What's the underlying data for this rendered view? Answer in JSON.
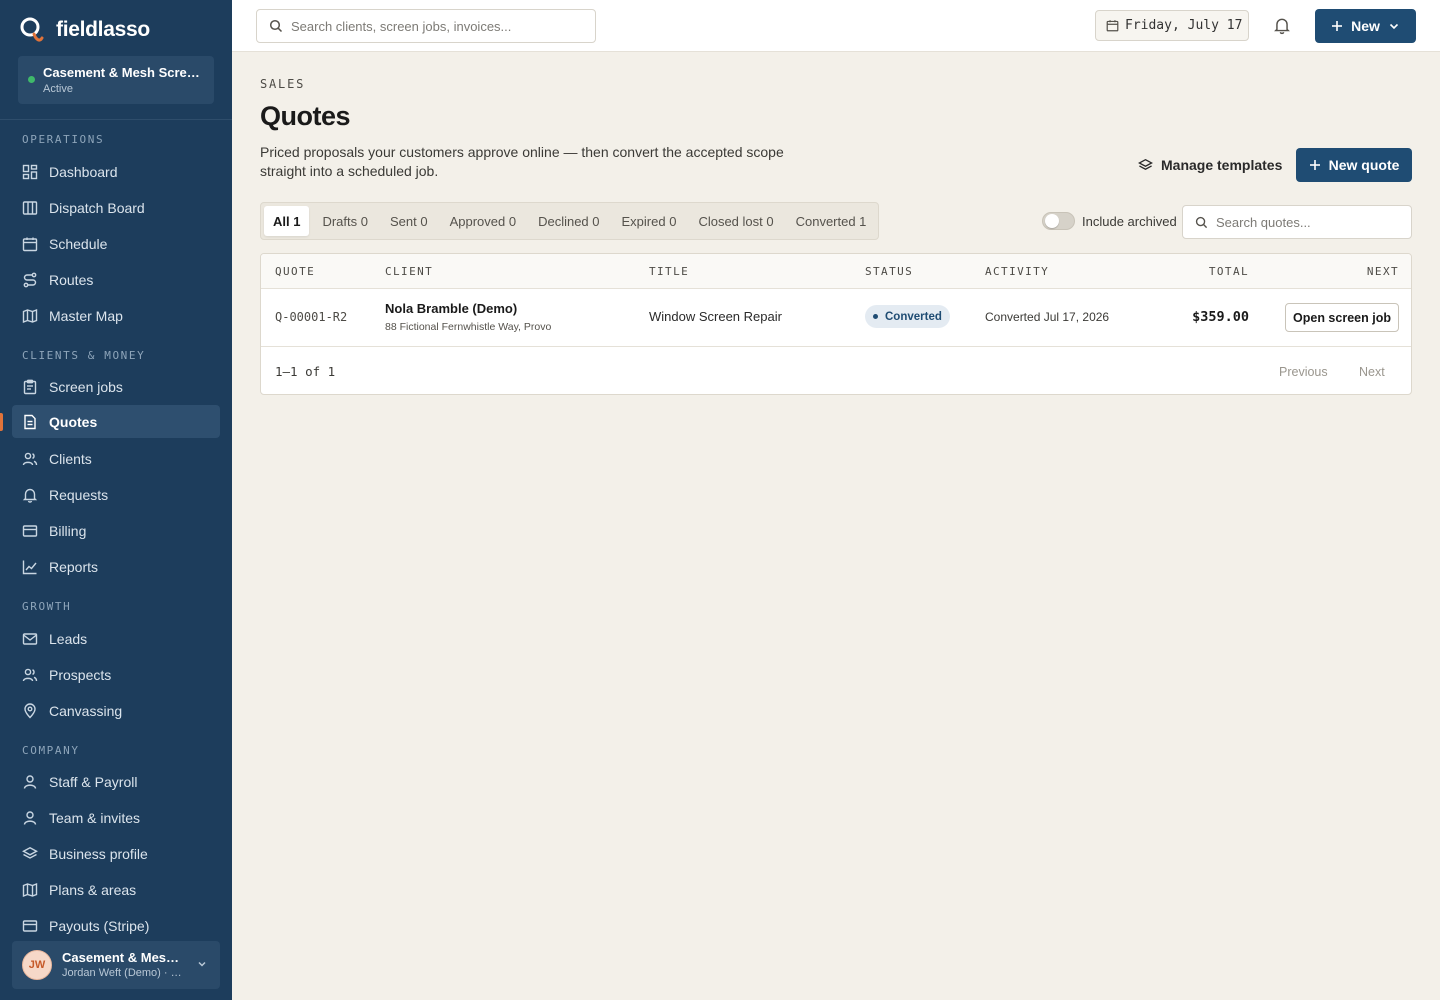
{
  "brand": {
    "name": "fieldlasso"
  },
  "org": {
    "name": "Casement & Mesh Screen...",
    "status": "Active"
  },
  "sidebar": {
    "sections": [
      {
        "label": "OPERATIONS"
      },
      {
        "label": "CLIENTS & MONEY"
      },
      {
        "label": "GROWTH"
      },
      {
        "label": "COMPANY"
      }
    ],
    "items": [
      {
        "label": "Dashboard",
        "icon": "dashboard-icon"
      },
      {
        "label": "Dispatch Board",
        "icon": "board-icon"
      },
      {
        "label": "Schedule",
        "icon": "calendar-icon"
      },
      {
        "label": "Routes",
        "icon": "route-icon"
      },
      {
        "label": "Master Map",
        "icon": "map-icon"
      },
      {
        "label": "Screen jobs",
        "icon": "clipboard-icon"
      },
      {
        "label": "Quotes",
        "icon": "document-icon",
        "active": true
      },
      {
        "label": "Clients",
        "icon": "users-icon"
      },
      {
        "label": "Requests",
        "icon": "bell-icon"
      },
      {
        "label": "Billing",
        "icon": "card-icon"
      },
      {
        "label": "Reports",
        "icon": "chart-icon"
      },
      {
        "label": "Leads",
        "icon": "mail-icon"
      },
      {
        "label": "Prospects",
        "icon": "users-icon"
      },
      {
        "label": "Canvassing",
        "icon": "pin-icon"
      },
      {
        "label": "Staff & Payroll",
        "icon": "user-icon"
      },
      {
        "label": "Team & invites",
        "icon": "user-icon"
      },
      {
        "label": "Business profile",
        "icon": "layers-icon"
      },
      {
        "label": "Plans & areas",
        "icon": "map-icon"
      },
      {
        "label": "Payouts (Stripe)",
        "icon": "card-icon"
      }
    ]
  },
  "user": {
    "initials": "JW",
    "org": "Casement & Mesh ...",
    "name": "Jordan Weft (Demo) · O..."
  },
  "topbar": {
    "search_placeholder": "Search clients, screen jobs, invoices...",
    "date": "Friday, July 17",
    "new_label": "New"
  },
  "page": {
    "eyebrow": "SALES",
    "title": "Quotes",
    "description": "Priced proposals your customers approve online — then convert the accepted scope straight into a scheduled job.",
    "manage_templates": "Manage templates",
    "new_quote": "New quote"
  },
  "tabs": [
    {
      "label": "All 1",
      "active": true
    },
    {
      "label": "Drafts 0"
    },
    {
      "label": "Sent 0"
    },
    {
      "label": "Approved 0"
    },
    {
      "label": "Declined 0"
    },
    {
      "label": "Expired 0"
    },
    {
      "label": "Closed lost 0"
    },
    {
      "label": "Converted 1"
    }
  ],
  "filters": {
    "include_archived": "Include archived",
    "include_archived_on": false,
    "search_placeholder": "Search quotes..."
  },
  "table": {
    "headers": {
      "quote": "QUOTE",
      "client": "CLIENT",
      "title": "TITLE",
      "status": "STATUS",
      "activity": "ACTIVITY",
      "total": "TOTAL",
      "next": "NEXT"
    },
    "rows": [
      {
        "quote": "Q-00001-R2",
        "client_name": "Nola Bramble (Demo)",
        "client_address": "88 Fictional Fernwhistle Way, Provo",
        "title": "Window Screen Repair",
        "status": "Converted",
        "activity": "Converted Jul 17, 2026",
        "total": "$359.00",
        "next": "Open screen job"
      }
    ],
    "pager": {
      "info": "1–1 of 1",
      "previous": "Previous",
      "next": "Next"
    }
  },
  "colors": {
    "sidebar": "#1d3d5c",
    "accent": "#1f4c73",
    "brand_orange": "#e0733a",
    "background": "#f3f0e9"
  }
}
